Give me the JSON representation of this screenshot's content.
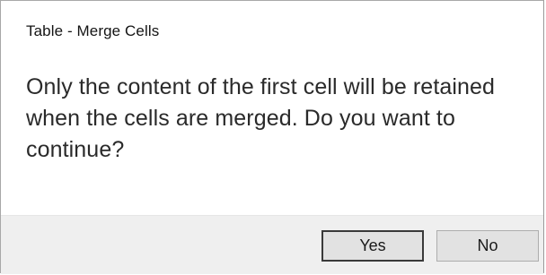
{
  "dialog": {
    "title": "Table - Merge Cells",
    "message": "Only the content of the first cell will be retained when the cells are merged. Do you want to continue?",
    "buttons": {
      "yes_label": "Yes",
      "no_label": "No"
    }
  },
  "colors": {
    "background": "#ffffff",
    "button_bar": "#efefef",
    "button_face": "#e2e2e2",
    "default_button_border": "#3a3a3a"
  }
}
